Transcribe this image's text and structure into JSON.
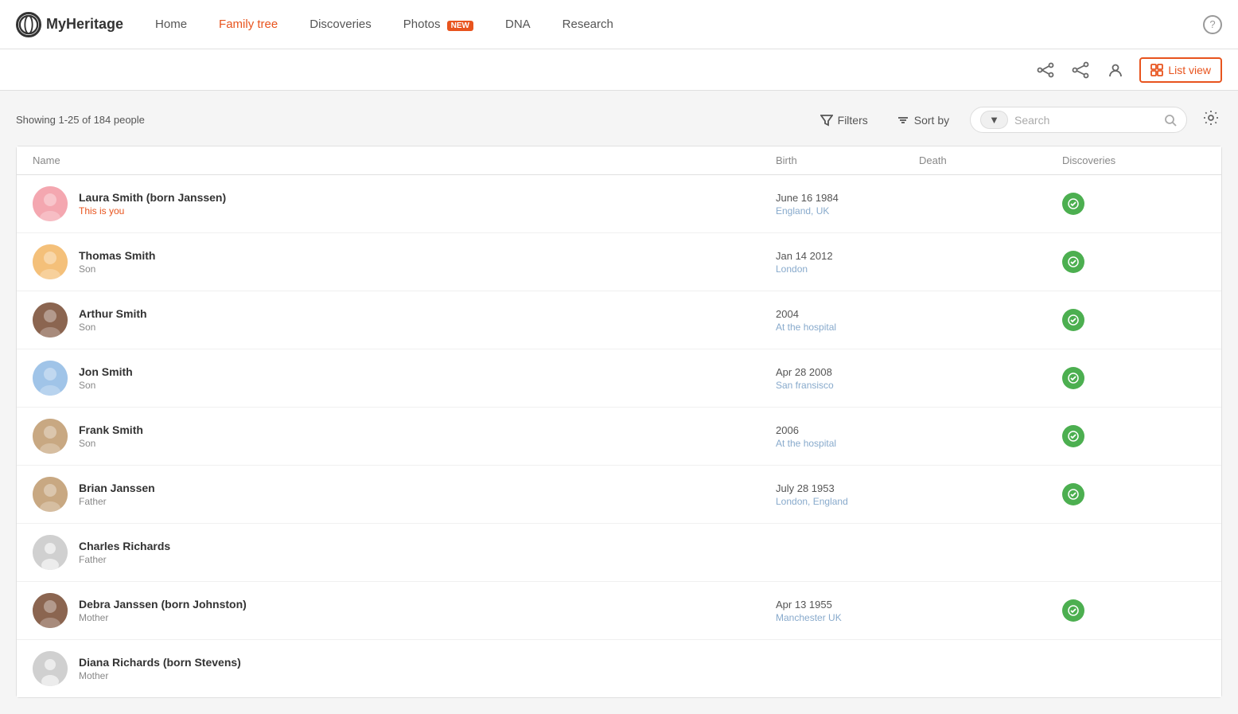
{
  "brand": {
    "logo_text": "MyHeritage",
    "logo_initial": "MH"
  },
  "nav": {
    "links": [
      {
        "label": "Home",
        "active": false
      },
      {
        "label": "Family tree",
        "active": true
      },
      {
        "label": "Discoveries",
        "active": false
      },
      {
        "label": "Photos",
        "active": false,
        "badge": "NEW"
      },
      {
        "label": "DNA",
        "active": false
      },
      {
        "label": "Research",
        "active": false
      }
    ],
    "help_label": "?"
  },
  "secondary_toolbar": {
    "list_view_label": "List view",
    "icons": [
      "fork-icon",
      "share-icon",
      "person-icon"
    ]
  },
  "filter_bar": {
    "showing_text": "Showing 1-25 of 184 people",
    "filters_label": "Filters",
    "sort_by_label": "Sort by",
    "search_placeholder": "Search",
    "search_dropdown_label": "▼"
  },
  "table": {
    "headers": [
      "Name",
      "Birth",
      "Death",
      "Discoveries"
    ],
    "rows": [
      {
        "name": "Laura Smith (born Janssen)",
        "relation_type": "you",
        "relation": "This is you",
        "birth_date": "June 16 1984",
        "birth_place": "England, UK",
        "death": "",
        "has_discoveries": true,
        "avatar_color": "av-pink",
        "avatar_type": "female"
      },
      {
        "name": "Thomas Smith",
        "relation_type": "normal",
        "relation": "Son",
        "birth_date": "Jan 14 2012",
        "birth_place": "London",
        "death": "",
        "has_discoveries": true,
        "avatar_color": "av-orange",
        "avatar_type": "baby"
      },
      {
        "name": "Arthur Smith",
        "relation_type": "normal",
        "relation": "Son",
        "birth_date": "2004",
        "birth_place": "At the hospital",
        "death": "",
        "has_discoveries": true,
        "avatar_color": "av-brown",
        "avatar_type": "boy"
      },
      {
        "name": "Jon Smith",
        "relation_type": "normal",
        "relation": "Son",
        "birth_date": "Apr 28 2008",
        "birth_place": "San fransisco",
        "death": "",
        "has_discoveries": true,
        "avatar_color": "av-blue",
        "avatar_type": "toddler"
      },
      {
        "name": "Frank Smith",
        "relation_type": "normal",
        "relation": "Son",
        "birth_date": "2006",
        "birth_place": "At the hospital",
        "death": "",
        "has_discoveries": true,
        "avatar_color": "av-tan",
        "avatar_type": "toddler2"
      },
      {
        "name": "Brian Janssen",
        "relation_type": "normal",
        "relation": "Father",
        "birth_date": "July 28 1953",
        "birth_place": "London, England",
        "death": "",
        "has_discoveries": true,
        "avatar_color": "av-tan",
        "avatar_type": "male-hat"
      },
      {
        "name": "Charles Richards",
        "relation_type": "normal",
        "relation": "Father",
        "birth_date": "",
        "birth_place": "",
        "death": "",
        "has_discoveries": false,
        "avatar_color": "av-gray",
        "avatar_type": "silhouette-male"
      },
      {
        "name": "Debra Janssen (born Johnston)",
        "relation_type": "normal",
        "relation": "Mother",
        "birth_date": "Apr 13 1955",
        "birth_place": "Manchester UK",
        "death": "",
        "has_discoveries": true,
        "avatar_color": "av-brown",
        "avatar_type": "female2"
      },
      {
        "name": "Diana Richards (born Stevens)",
        "relation_type": "normal",
        "relation": "Mother",
        "birth_date": "",
        "birth_place": "",
        "death": "",
        "has_discoveries": false,
        "avatar_color": "av-gray",
        "avatar_type": "silhouette-female"
      }
    ]
  }
}
